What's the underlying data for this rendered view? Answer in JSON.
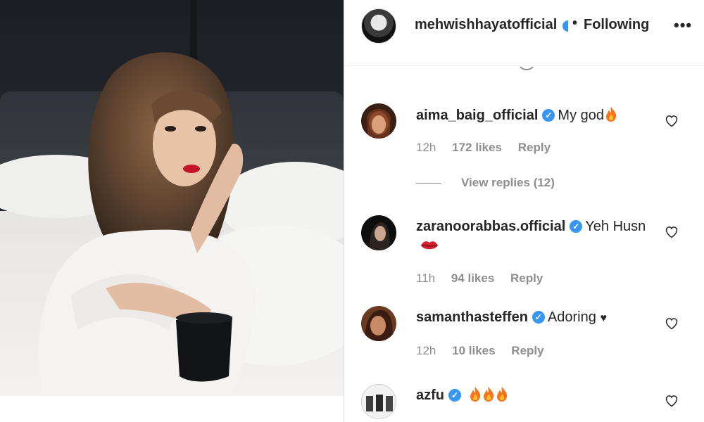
{
  "header": {
    "username": "mehwishhayatofficial",
    "separator": "•",
    "follow_state": "Following",
    "more_label": "•••"
  },
  "comments": [
    {
      "username": "aima_baig_official",
      "verified": true,
      "text": "My god",
      "emoji": [
        "fire"
      ],
      "time": "12h",
      "likes": "172 likes",
      "reply": "Reply",
      "view_replies": "View replies (12)"
    },
    {
      "username": "zaranoorabbas.official",
      "verified": true,
      "text": "Yeh Husn",
      "emoji": [
        "kiss"
      ],
      "time": "11h",
      "likes": "94 likes",
      "reply": "Reply"
    },
    {
      "username": "samanthasteffen",
      "verified": true,
      "text": "Adoring",
      "emoji": [
        "black-heart"
      ],
      "time": "12h",
      "likes": "10 likes",
      "reply": "Reply"
    },
    {
      "username": "azfu",
      "verified": true,
      "text": "",
      "emoji": [
        "fire",
        "fire",
        "fire"
      ]
    }
  ],
  "icons": {
    "verified": "verified-badge-icon",
    "like": "heart-outline-icon",
    "more": "more-options-icon"
  },
  "colors": {
    "verified_blue": "#3897f0",
    "muted_text": "#8e8e8e",
    "primary_text": "#262626"
  }
}
